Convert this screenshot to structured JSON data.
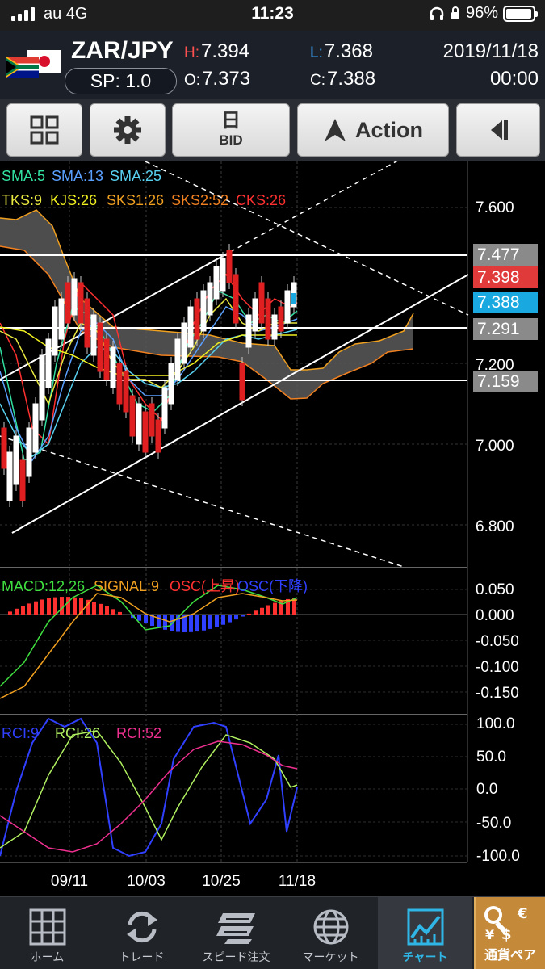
{
  "status_bar": {
    "carrier": "au 4G",
    "time": "11:23",
    "battery": "96%",
    "battery_level": 0.96
  },
  "header": {
    "pair": "ZAR/JPY",
    "spread": "SP: 1.0",
    "high_key": "H:",
    "high": "7.394",
    "open_key": "O:",
    "open": "7.373",
    "low_key": "L:",
    "low": "7.368",
    "close_key": "C:",
    "close": "7.388",
    "date": "2019/11/18",
    "time": "00:00"
  },
  "toolbar": {
    "timeframe": "日",
    "price_type": "BID",
    "action_label": "Action"
  },
  "chart": {
    "legend_sma": [
      {
        "label": "SMA:5",
        "color": "#32e0a0"
      },
      {
        "label": "SMA:13",
        "color": "#5aa0ff"
      },
      {
        "label": "SMA:25",
        "color": "#58d0f0"
      }
    ],
    "legend_ichimoku": [
      {
        "label": "TKS:9",
        "color": "#e8e840"
      },
      {
        "label": "KJS:26",
        "color": "#f0f020"
      },
      {
        "label": "SKS1:26",
        "color": "#f0a020"
      },
      {
        "label": "SKS2:52",
        "color": "#f08020"
      },
      {
        "label": "CKS:26",
        "color": "#ff3030"
      }
    ],
    "price_axis": [
      "7.600",
      "7.200",
      "7.000",
      "6.800"
    ],
    "price_tags": [
      {
        "value": "7.477",
        "color": "#8a8a8a"
      },
      {
        "value": "7.398",
        "color": "#e03a3a"
      },
      {
        "value": "7.388",
        "color": "#1aa8e0"
      },
      {
        "value": "7.291",
        "color": "#8a8a8a"
      },
      {
        "value": "7.159",
        "color": "#8a8a8a"
      }
    ],
    "macd_legend": [
      {
        "label": "MACD:12,26",
        "color": "#40e040"
      },
      {
        "label": "SIGNAL:9",
        "color": "#f0a020"
      },
      {
        "label": "OSC(上昇)",
        "color": "#ff3030"
      },
      {
        "label": "OSC(下降)",
        "color": "#3040ff"
      }
    ],
    "macd_axis": [
      "0.050",
      "0.000",
      "-0.050",
      "-0.100",
      "-0.150"
    ],
    "rci_legend": [
      {
        "label": "RCI:9",
        "color": "#3040ff"
      },
      {
        "label": "RCI:26",
        "color": "#b0f060"
      },
      {
        "label": "RCI:52",
        "color": "#f03090"
      }
    ],
    "rci_axis": [
      "100.0",
      "50.0",
      "0.0",
      "-50.0",
      "-100.0"
    ],
    "x_axis": [
      "09/11",
      "10/03",
      "10/25",
      "11/18"
    ]
  },
  "tabs": [
    {
      "label": "ホーム",
      "icon": "home-grid-icon"
    },
    {
      "label": "トレード",
      "icon": "trade-arrows-icon"
    },
    {
      "label": "スピード注文",
      "icon": "speed-order-icon"
    },
    {
      "label": "マーケット",
      "icon": "market-globe-icon"
    },
    {
      "label": "チャート",
      "icon": "chart-icon"
    }
  ],
  "pair_tab": {
    "label": "通貨ペア",
    "icon": "currency-pair-icon"
  }
}
